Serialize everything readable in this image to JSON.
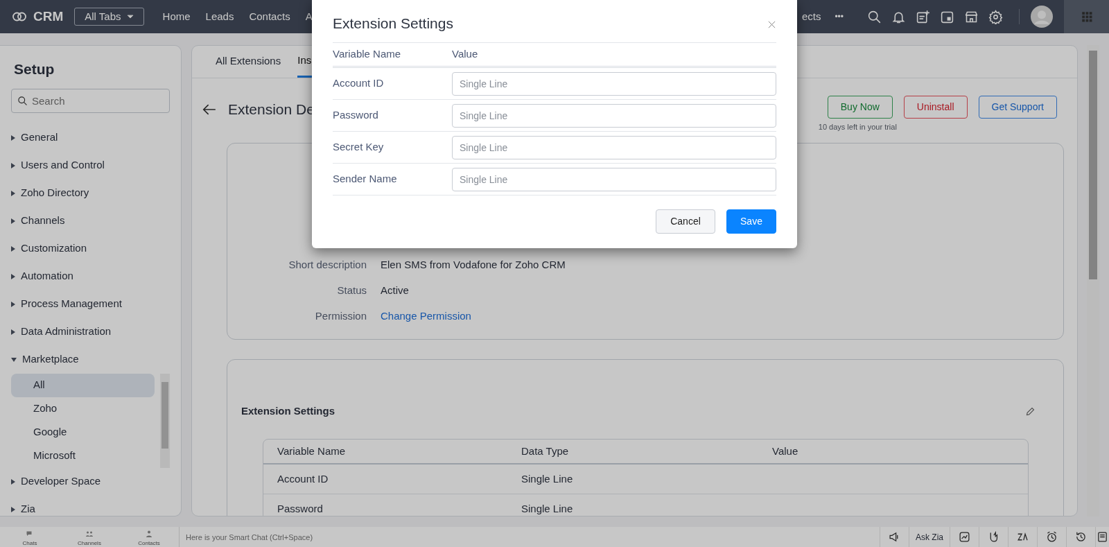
{
  "navbar": {
    "logo": "CRM",
    "all_tabs": "All Tabs",
    "tabs": [
      {
        "label": "Home"
      },
      {
        "label": "Leads"
      },
      {
        "label": "Contacts"
      },
      {
        "label": "A"
      }
    ],
    "tabs_right": [
      {
        "label": "ects"
      }
    ],
    "more": "•••"
  },
  "sidebar": {
    "title": "Setup",
    "search_placeholder": "Search",
    "items": [
      {
        "label": "General",
        "expanded": false
      },
      {
        "label": "Users and Control",
        "expanded": false
      },
      {
        "label": "Zoho Directory",
        "expanded": false
      },
      {
        "label": "Channels",
        "expanded": false
      },
      {
        "label": "Customization",
        "expanded": false
      },
      {
        "label": "Automation",
        "expanded": false
      },
      {
        "label": "Process Management",
        "expanded": false
      },
      {
        "label": "Data Administration",
        "expanded": false
      },
      {
        "label": "Marketplace",
        "expanded": true,
        "children": [
          {
            "label": "All",
            "selected": true
          },
          {
            "label": "Zoho",
            "selected": false
          },
          {
            "label": "Google",
            "selected": false
          },
          {
            "label": "Microsoft",
            "selected": false
          }
        ]
      },
      {
        "label": "Developer Space",
        "expanded": false
      },
      {
        "label": "Zia",
        "expanded": false
      }
    ]
  },
  "content": {
    "tabs": [
      {
        "label": "All Extensions",
        "selected": false
      },
      {
        "label": "Ins",
        "selected": true
      }
    ],
    "heading": "Extension De",
    "buttons": [
      {
        "label": "Buy Now",
        "kind": "success"
      },
      {
        "label": "Uninstall",
        "kind": "danger"
      },
      {
        "label": "Get Support",
        "kind": "primary"
      }
    ],
    "trial_note": "10 days left in your trial",
    "details": [
      {
        "label": "Short description",
        "value": "Elen SMS from Vodafone for Zoho CRM",
        "kind": "text"
      },
      {
        "label": "Status",
        "value": "Active",
        "kind": "text"
      },
      {
        "label": "Permission",
        "value": "Change Permission",
        "kind": "link"
      }
    ],
    "settings": {
      "title": "Extension Settings",
      "columns": [
        "Variable Name",
        "Data Type",
        "Value"
      ],
      "rows": [
        [
          "Account ID",
          "Single Line"
        ],
        [
          "Password",
          "Single Line"
        ]
      ]
    }
  },
  "modal": {
    "title": "Extension Settings",
    "columns": [
      "Variable Name",
      "Value"
    ],
    "fields": [
      {
        "label": "Account ID",
        "placeholder": "Single Line"
      },
      {
        "label": "Password",
        "placeholder": "Single Line"
      },
      {
        "label": "Secret Key",
        "placeholder": "Single Line"
      },
      {
        "label": "Sender Name",
        "placeholder": "Single Line"
      }
    ],
    "buttons": [
      {
        "label": "Cancel",
        "kind": "secondary"
      },
      {
        "label": "Save",
        "kind": "primary"
      }
    ]
  },
  "bottom_bar": {
    "apps": [
      "Chats",
      "Channels",
      "Contacts"
    ],
    "chat_placeholder": "Here is your Smart Chat (Ctrl+Space)",
    "ask_zia": "Ask Zia"
  }
}
